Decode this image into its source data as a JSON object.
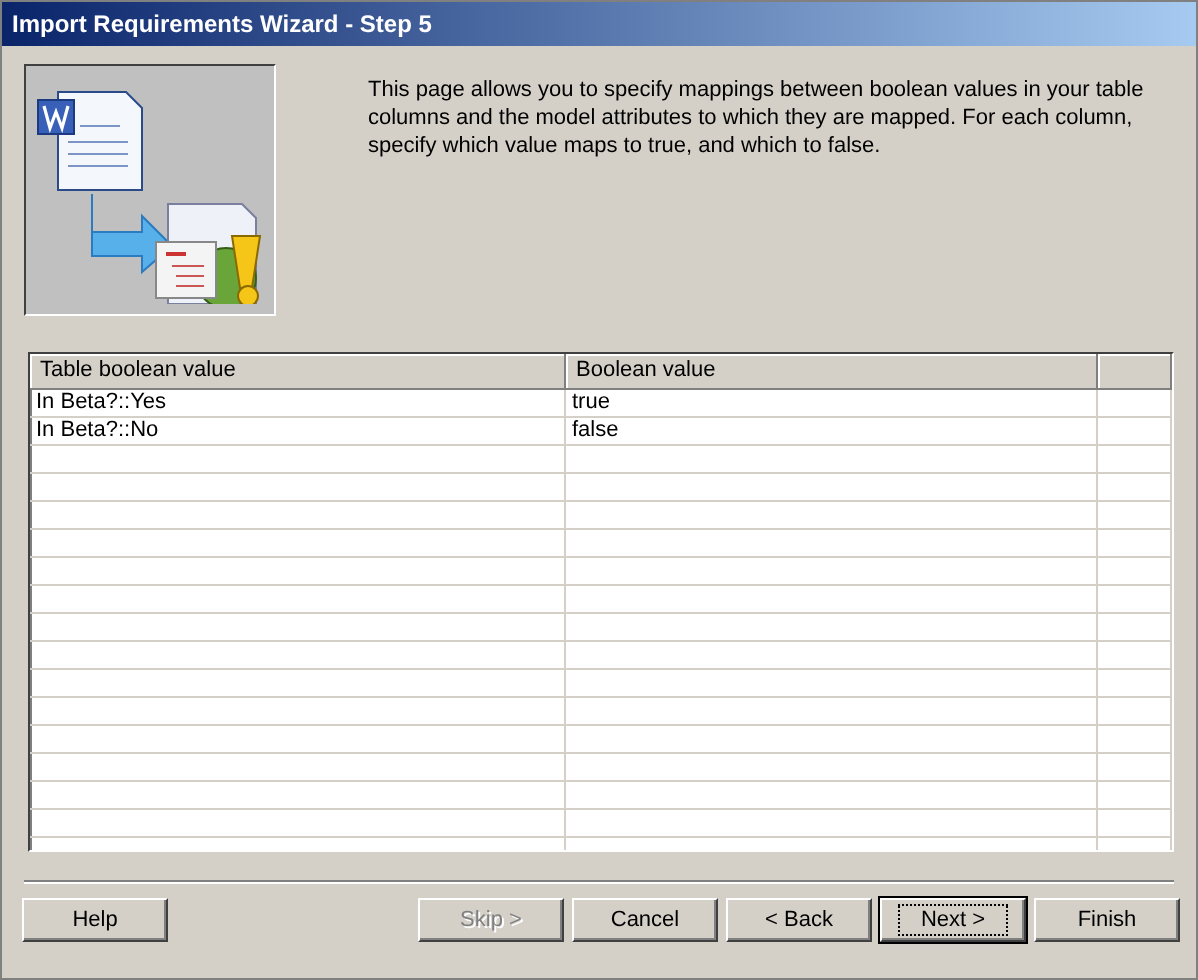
{
  "window": {
    "title": "Import Requirements Wizard - Step 5"
  },
  "description": "This page allows you to specify mappings between boolean values in your table columns and the model attributes to which they are mapped. For each column, specify which value maps to true, and which to false.",
  "table": {
    "columns": [
      "Table boolean value",
      "Boolean value"
    ],
    "rows": [
      {
        "cells": [
          "In Beta?::Yes",
          "true"
        ]
      },
      {
        "cells": [
          "In Beta?::No",
          "false"
        ]
      }
    ]
  },
  "buttons": [
    {
      "label": "Help",
      "disabled": false,
      "default": false
    },
    {
      "label": "Skip >",
      "disabled": true,
      "default": false
    },
    {
      "label": "Cancel",
      "disabled": false,
      "default": false
    },
    {
      "label": "< Back",
      "disabled": false,
      "default": false
    },
    {
      "label": "Next >",
      "disabled": false,
      "default": true
    },
    {
      "label": "Finish",
      "disabled": false,
      "default": false
    }
  ]
}
